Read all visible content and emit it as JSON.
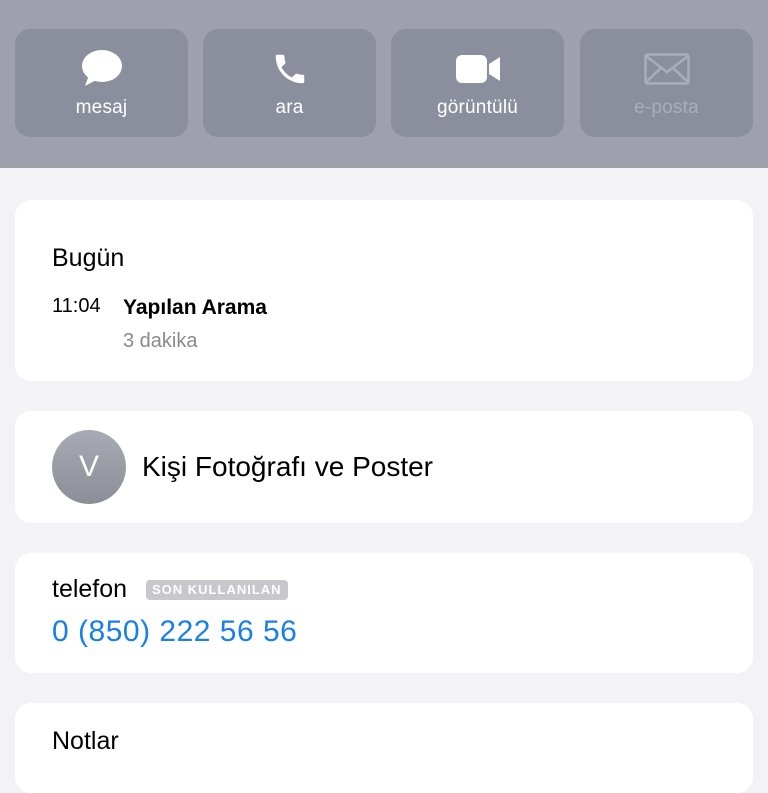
{
  "actions": [
    {
      "label": "mesaj",
      "icon": "message-icon",
      "enabled": true
    },
    {
      "label": "ara",
      "icon": "phone-icon",
      "enabled": true
    },
    {
      "label": "görüntülü",
      "icon": "video-icon",
      "enabled": true
    },
    {
      "label": "e-posta",
      "icon": "mail-icon",
      "enabled": false
    }
  ],
  "history": {
    "day": "Bugün",
    "time": "11:04",
    "title": "Yapılan Arama",
    "duration": "3 dakika"
  },
  "photo": {
    "initial": "V",
    "label": "Kişi Fotoğrafı ve Poster"
  },
  "phone": {
    "label": "telefon",
    "badge": "SON KULLANILAN",
    "number": "0 (850) 222 56 56"
  },
  "notes": {
    "label": "Notlar"
  },
  "colors": {
    "header_bg": "#9ea1ad",
    "action_bg": "#8b8f9d",
    "link_blue": "#1a7fe6",
    "page_bg": "#f2f2f7"
  }
}
